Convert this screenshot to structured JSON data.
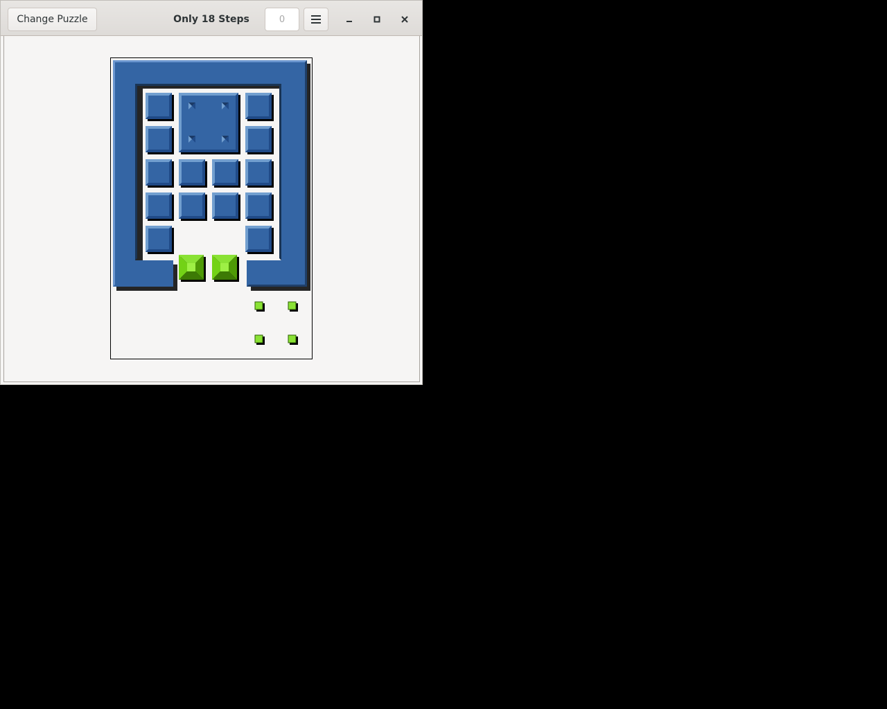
{
  "window": {
    "title": "Only 18 Steps",
    "steps_count": "0"
  },
  "headerbar": {
    "change_puzzle_label": "Change Puzzle",
    "menu_icon": "hamburger-menu-icon",
    "minimize_icon": "minimize-icon",
    "maximize_icon": "maximize-icon",
    "close_icon": "close-icon"
  },
  "colors": {
    "wall_blue": "#3465a4",
    "block_green": "#73d216",
    "background": "#f6f5f4",
    "desktop": "#000000"
  },
  "puzzle": {
    "grid_columns": 6,
    "grid_rows": 9,
    "small_blue_blocks": 14,
    "large_blue_block": "2x2 with corner markers",
    "green_blocks": 2,
    "green_targets": 4
  }
}
